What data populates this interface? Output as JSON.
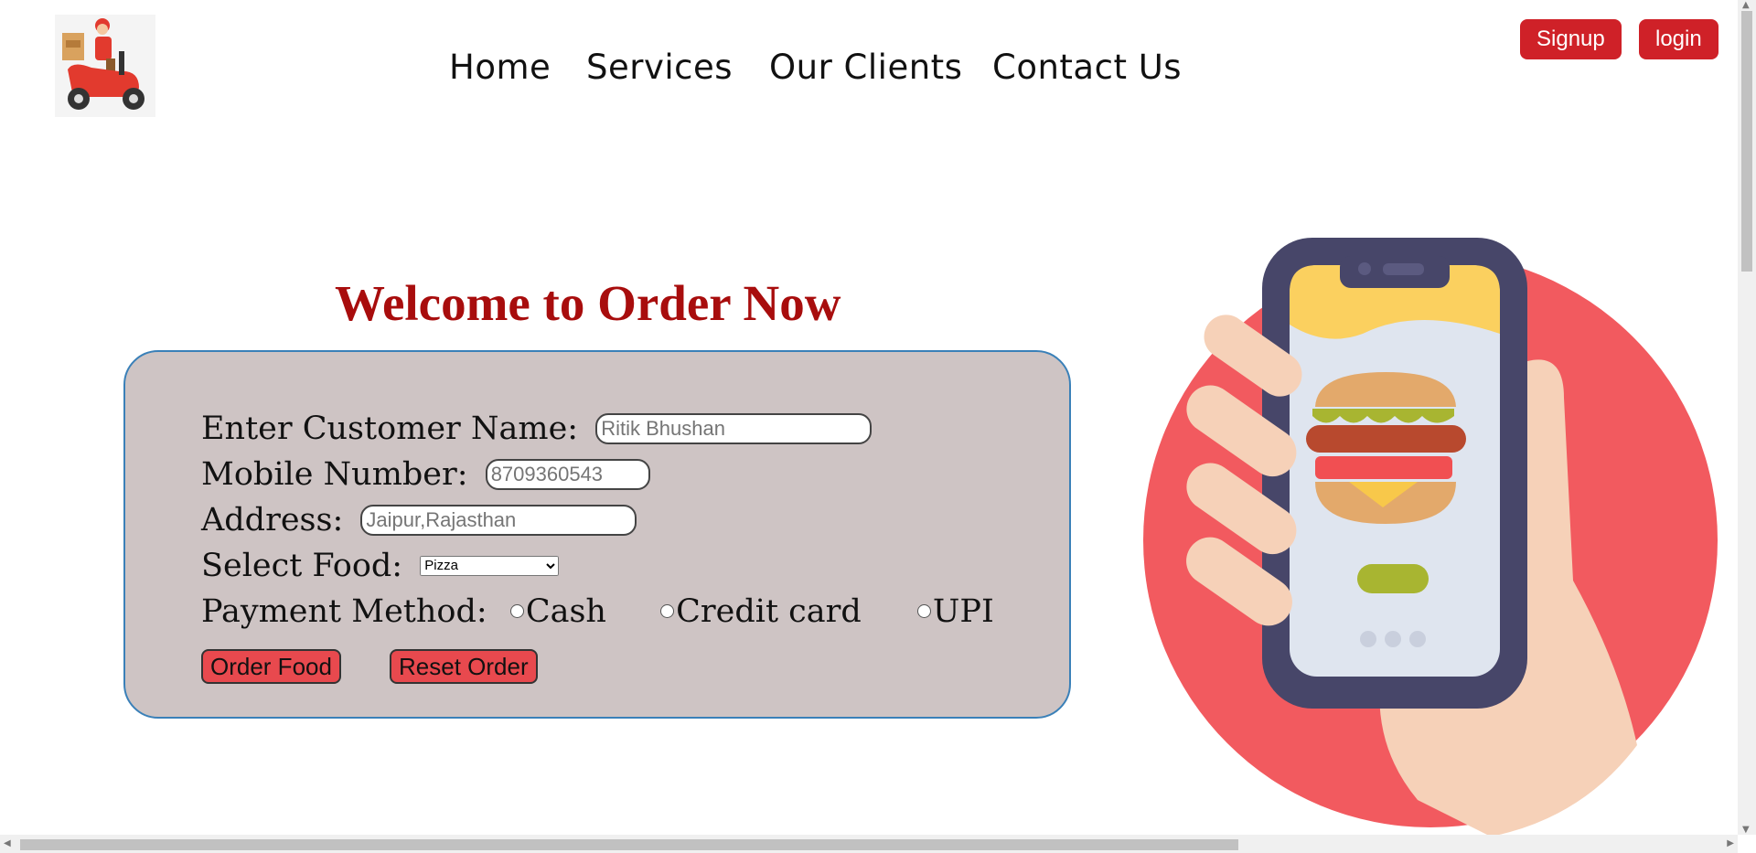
{
  "nav": {
    "items": [
      "Home",
      "Services",
      "Our Clients",
      "Contact Us"
    ]
  },
  "auth": {
    "signup_label": "Signup",
    "login_label": "login"
  },
  "main": {
    "title": "Welcome to Order Now",
    "form": {
      "name_label": "Enter Customer Name:",
      "name_placeholder": "Ritik Bhushan",
      "mobile_label": "Mobile Number:",
      "mobile_placeholder": "8709360543",
      "address_label": "Address:",
      "address_placeholder": "Jaipur,Rajasthan",
      "food_label": "Select Food:",
      "food_selected": "Pizza",
      "payment_label": "Payment Method:",
      "payment_options": [
        "Cash",
        "Credit card",
        "UPI"
      ],
      "order_button": "Order Food",
      "reset_button": "Reset Order"
    }
  },
  "colors": {
    "accent_red": "#cf2128",
    "title_red": "#a80d0d",
    "form_bg": "#cec4c4",
    "form_border": "#3a80b8",
    "button_red": "#e8494e",
    "circle_red": "#f25a5f"
  },
  "icons": {
    "logo": "delivery-scooter-logo",
    "illustration": "phone-burger-hand-illustration"
  }
}
